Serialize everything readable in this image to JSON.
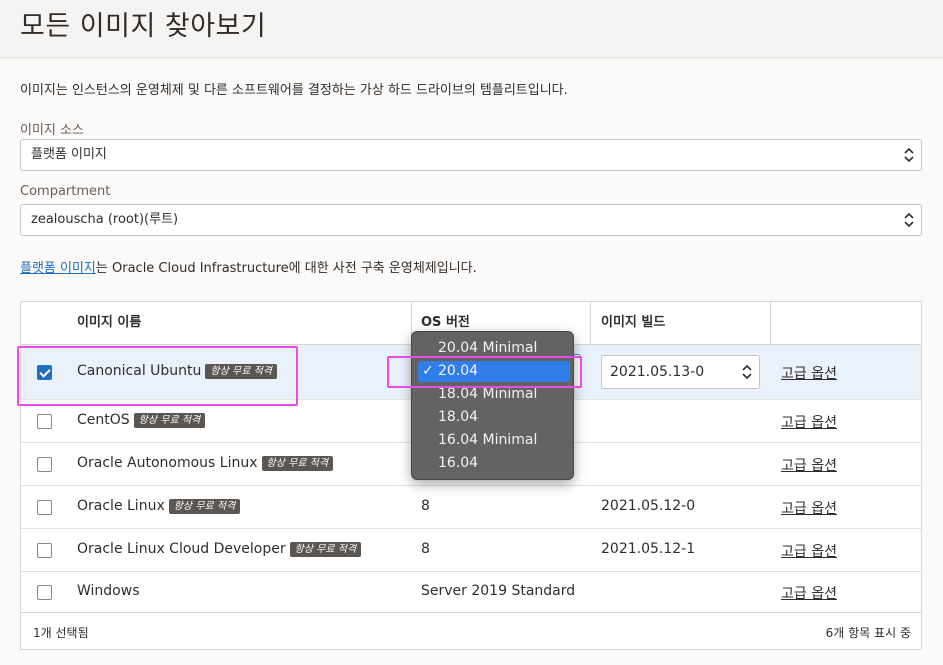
{
  "page": {
    "title": "모든 이미지 찾아보기",
    "description": "이미지는 인스턴스의 운영체제 및 다른 소프트웨어를 결정하는 가상 하드 드라이브의 템플리트입니다."
  },
  "image_source": {
    "label": "이미지 소스",
    "value": "플랫폼 이미지"
  },
  "compartment": {
    "label": "Compartment",
    "value": "zealouscha (root)(루트)"
  },
  "info": {
    "link_text": "플랫폼 이미지",
    "text": "는 Oracle Cloud Infrastructure에 대한 사전 구축 운영체제입니다."
  },
  "table": {
    "headers": {
      "name": "이미지 이름",
      "os_version": "OS 버전",
      "build": "이미지 빌드"
    },
    "badge_label": "항상 무료 적격",
    "advanced_link": "고급 옵션",
    "rows": [
      {
        "name": "Canonical Ubuntu",
        "os": "20.04",
        "build": "2021.05.13-0",
        "checked": true,
        "badge": true
      },
      {
        "name": "CentOS",
        "os": "",
        "build": "",
        "checked": false,
        "badge": true
      },
      {
        "name": "Oracle Autonomous Linux",
        "os": "",
        "build": "",
        "checked": false,
        "badge": true
      },
      {
        "name": "Oracle Linux",
        "os": "8",
        "build": "2021.05.12-0",
        "checked": false,
        "badge": true
      },
      {
        "name": "Oracle Linux Cloud Developer",
        "os": "8",
        "build": "2021.05.12-1",
        "checked": false,
        "badge": true
      },
      {
        "name": "Windows",
        "os": "Server 2019 Standard",
        "build": "",
        "checked": false,
        "badge": false
      }
    ],
    "footer": {
      "selected": "1개 선택됨",
      "count": "6개 항목 표시 중"
    }
  },
  "os_dropdown": {
    "options": [
      "20.04 Minimal",
      "20.04",
      "18.04 Minimal",
      "18.04",
      "16.04 Minimal",
      "16.04"
    ],
    "selected_index": 1,
    "check_glyph": "✓"
  },
  "colors": {
    "accent": "#1f6ec2",
    "highlight": "#e84be8",
    "menu_selected": "#2f7ee9"
  }
}
